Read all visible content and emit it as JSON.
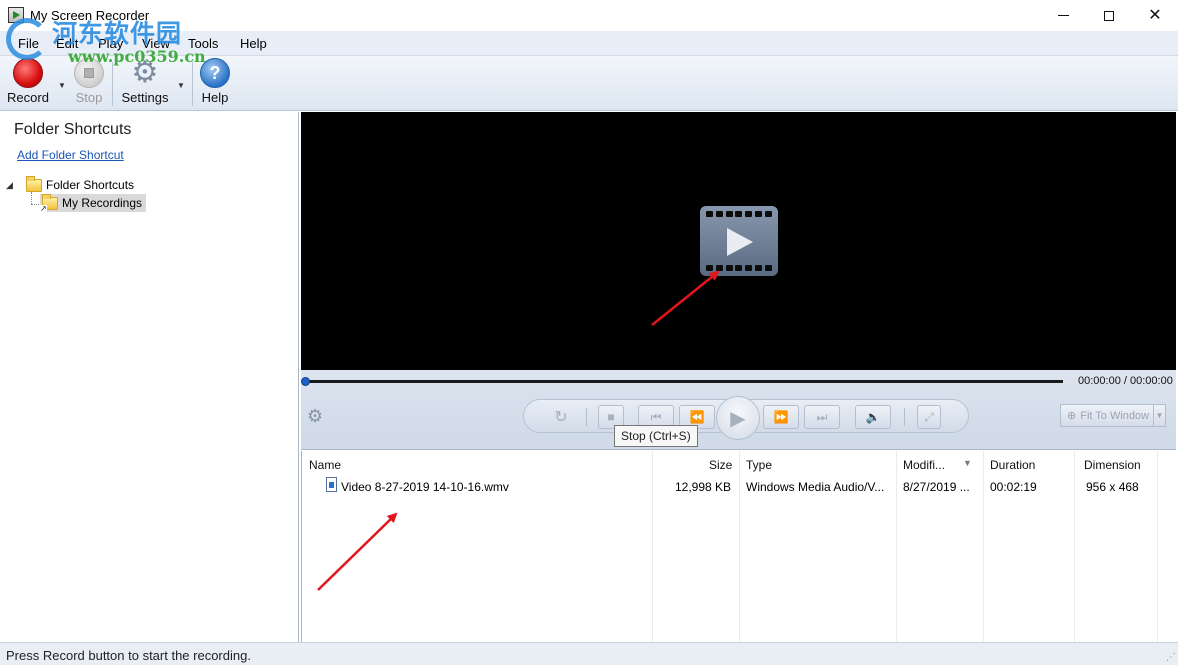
{
  "window": {
    "title": "My Screen Recorder",
    "watermark_text": "河东软件园",
    "watermark_url": "www.pc0359.cn"
  },
  "menu": [
    "File",
    "Edit",
    "Play",
    "View",
    "Tools",
    "Help"
  ],
  "toolbar": {
    "record_label": "Record",
    "stop_label": "Stop",
    "settings_label": "Settings",
    "help_label": "Help"
  },
  "sidebar": {
    "title": "Folder Shortcuts",
    "add_link": "Add Folder Shortcut",
    "tree_root": "Folder Shortcuts",
    "tree_child": "My Recordings"
  },
  "player": {
    "time": "00:00:00 / 00:00:00",
    "tooltip": "Stop (Ctrl+S)",
    "fit_label": "Fit To Window"
  },
  "file_list": {
    "columns": [
      "Name",
      "Size",
      "Type",
      "Modifi...",
      "Duration",
      "Dimension"
    ],
    "rows": [
      {
        "name": "Video 8-27-2019 14-10-16.wmv",
        "size": "12,998 KB",
        "type": "Windows Media Audio/V...",
        "modified": "8/27/2019 ...",
        "duration": "00:02:19",
        "dimension": "956 x 468"
      }
    ]
  },
  "status": {
    "text": "Press Record button to start the recording."
  },
  "colors": {
    "accent": "#1f63c9",
    "record_red": "#d80e0e",
    "annotation_arrow": "#e3141b"
  }
}
